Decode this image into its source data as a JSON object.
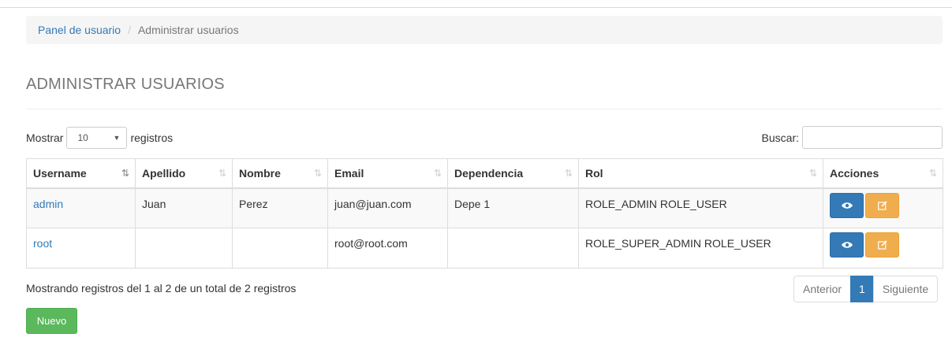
{
  "breadcrumb": {
    "home": "Panel de usuario",
    "separator": "/",
    "current": "Administrar usuarios"
  },
  "page_title": "ADMINISTRAR USUARIOS",
  "length": {
    "before": "Mostrar",
    "value": "10",
    "after": "registros"
  },
  "search": {
    "label": "Buscar:",
    "value": "",
    "placeholder": ""
  },
  "table": {
    "headers": [
      "Username",
      "Apellido",
      "Nombre",
      "Email",
      "Dependencia",
      "Rol",
      "Acciones"
    ],
    "sort_icon": "⇅",
    "sorted_icon": "⇂",
    "rows": [
      {
        "username": "admin",
        "apellido": "Juan",
        "nombre": "Perez",
        "email": "juan@juan.com",
        "dependencia": "Depe 1",
        "rol": "ROLE_ADMIN ROLE_USER"
      },
      {
        "username": "root",
        "apellido": "",
        "nombre": "",
        "email": "root@root.com",
        "dependencia": "",
        "rol": "ROLE_SUPER_ADMIN ROLE_USER"
      }
    ]
  },
  "info": "Mostrando registros del 1 al 2 de un total de 2 registros",
  "pagination": {
    "prev": "Anterior",
    "current": "1",
    "next": "Siguiente"
  },
  "new_button": "Nuevo",
  "colors": {
    "link": "#337ab7",
    "primary": "#337ab7",
    "warning": "#f0ad4e",
    "success": "#5cb85c"
  },
  "icons": {
    "view": "eye-icon",
    "edit": "pencil-icon"
  }
}
